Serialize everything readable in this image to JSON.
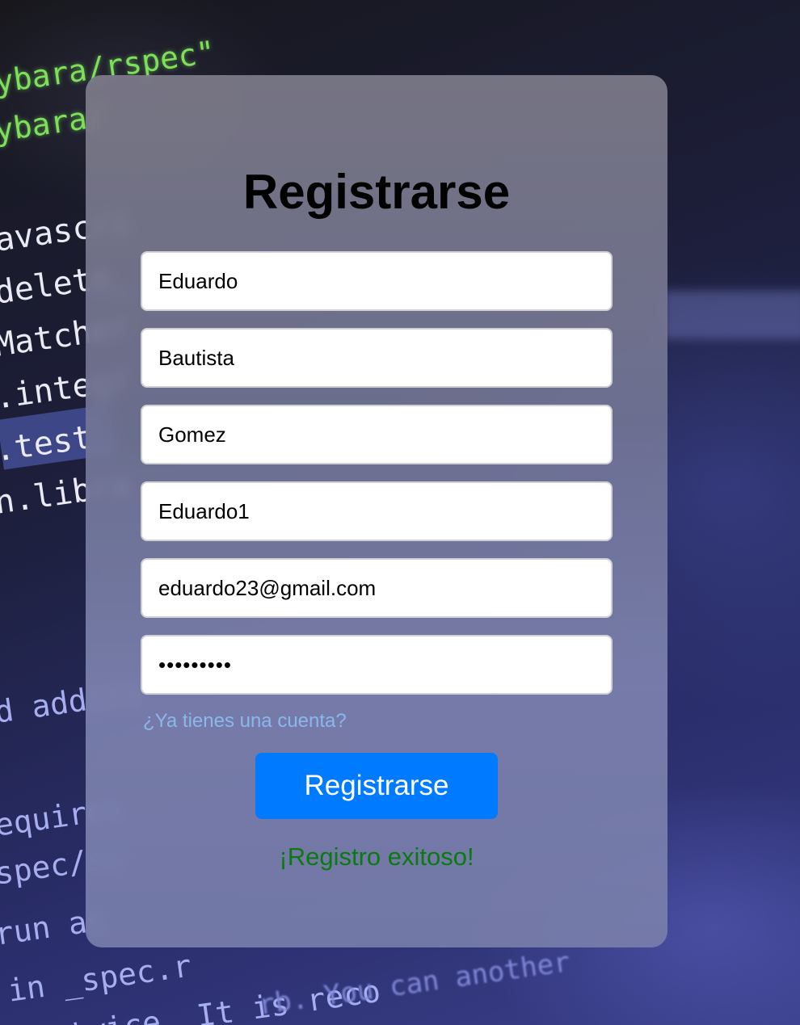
{
  "background": {
    "code_lines": [
      "ybara/rspec\"",
      "ybara/",
      "avascri",
      "delete_",
      "Matcher",
      ".integr",
      ".test_",
      "h.libra",
      "d additi",
      "equires",
      "spec/su",
      "run as",
      "in _spec.r",
      "n twice. It is reco",
      "rb. You can another"
    ]
  },
  "form": {
    "title": "Registrarse",
    "fields": [
      {
        "value": "Eduardo",
        "type": "text"
      },
      {
        "value": "Bautista",
        "type": "text"
      },
      {
        "value": "Gomez",
        "type": "text"
      },
      {
        "value": "Eduardo1",
        "type": "text"
      },
      {
        "value": "eduardo23@gmail.com",
        "type": "email"
      },
      {
        "value": "abcdefghi",
        "type": "password"
      }
    ],
    "login_link": "¿Ya tienes una cuenta?",
    "submit_label": "Registrarse",
    "success_message": "¡Registro exitoso!"
  },
  "colors": {
    "button": "#007bff",
    "link": "#8ab8ec",
    "success": "#0a7a10"
  }
}
